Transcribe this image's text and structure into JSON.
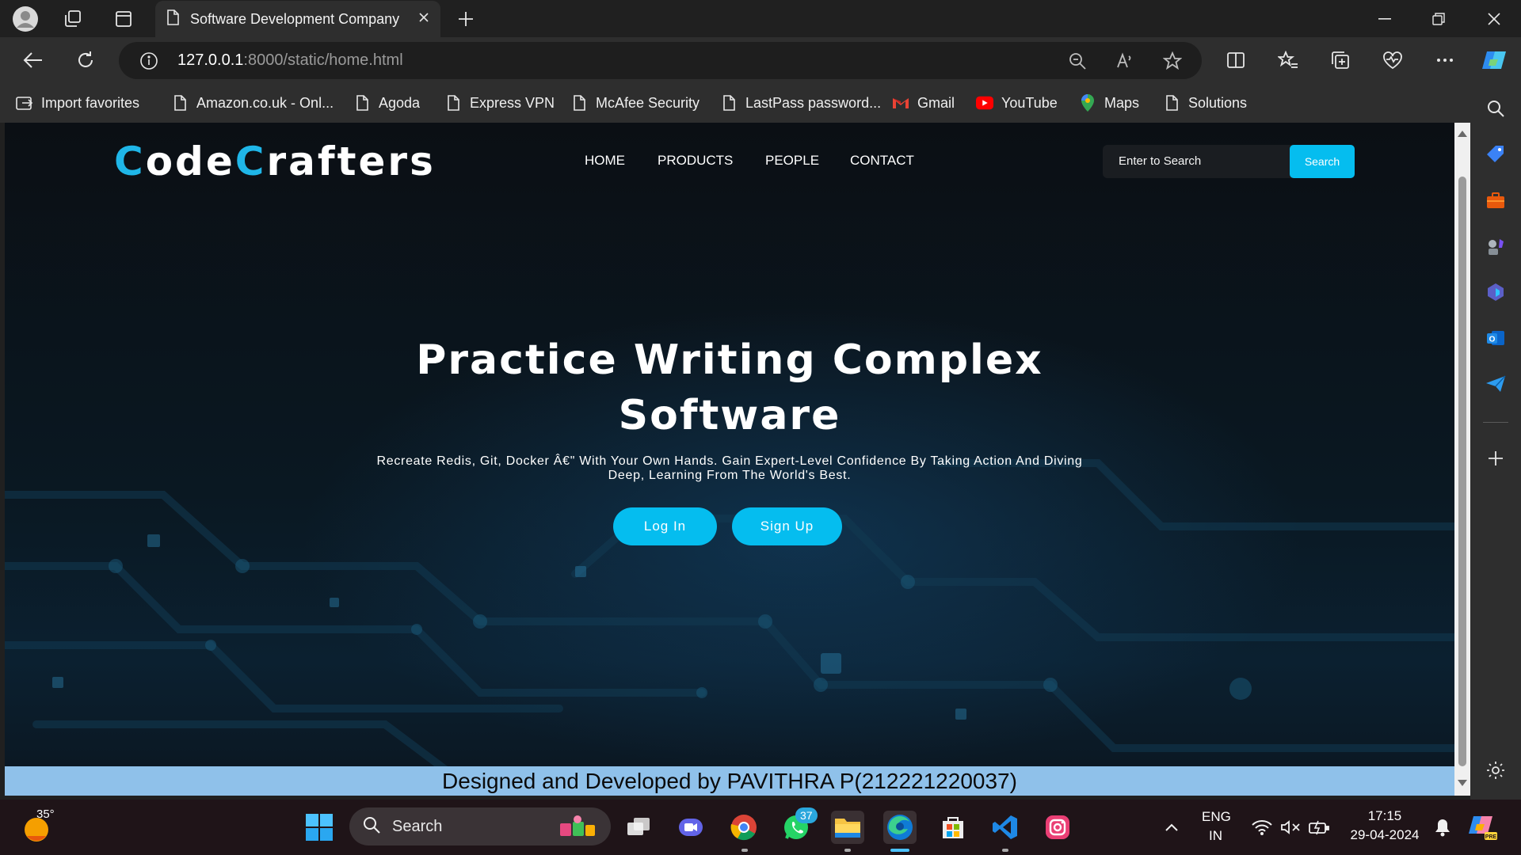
{
  "browser": {
    "tab_title": "Software Development Company",
    "url_host": "127.0.0.1",
    "url_rest": ":8000/static/home.html"
  },
  "favorites": [
    {
      "label": "Import favorites"
    },
    {
      "label": "Amazon.co.uk - Onl..."
    },
    {
      "label": "Agoda"
    },
    {
      "label": "Express VPN"
    },
    {
      "label": "McAfee Security"
    },
    {
      "label": "LastPass password..."
    },
    {
      "label": "Gmail"
    },
    {
      "label": "YouTube"
    },
    {
      "label": "Maps"
    },
    {
      "label": "Solutions"
    }
  ],
  "page": {
    "logo_c1": "C",
    "logo_rest1": "ode",
    "logo_c2": "C",
    "logo_rest2": "rafters",
    "nav": [
      "HOME",
      "PRODUCTS",
      "PEOPLE",
      "CONTACT"
    ],
    "search_placeholder": "Enter to Search",
    "search_button": "Search",
    "hero_title_line1": "Practice Writing Complex",
    "hero_title_line2": "Software",
    "hero_subtitle": "Recreate Redis, Git, Docker Â€\" With Your Own Hands. Gain Expert-Level Confidence By Taking Action And Diving Deep, Learning From The World's Best.",
    "login_button": "Log In",
    "signup_button": "Sign Up",
    "footer_text": "Designed and Developed by PAVITHRA P(212221220037)"
  },
  "taskbar": {
    "weather_temp": "35°",
    "search_label": "Search",
    "whatsapp_badge": "37",
    "lang_line1": "ENG",
    "lang_line2": "IN",
    "time": "17:15",
    "date": "29-04-2024"
  },
  "colors": {
    "accent": "#05bdef",
    "footer_bg": "#8fc1ea"
  }
}
